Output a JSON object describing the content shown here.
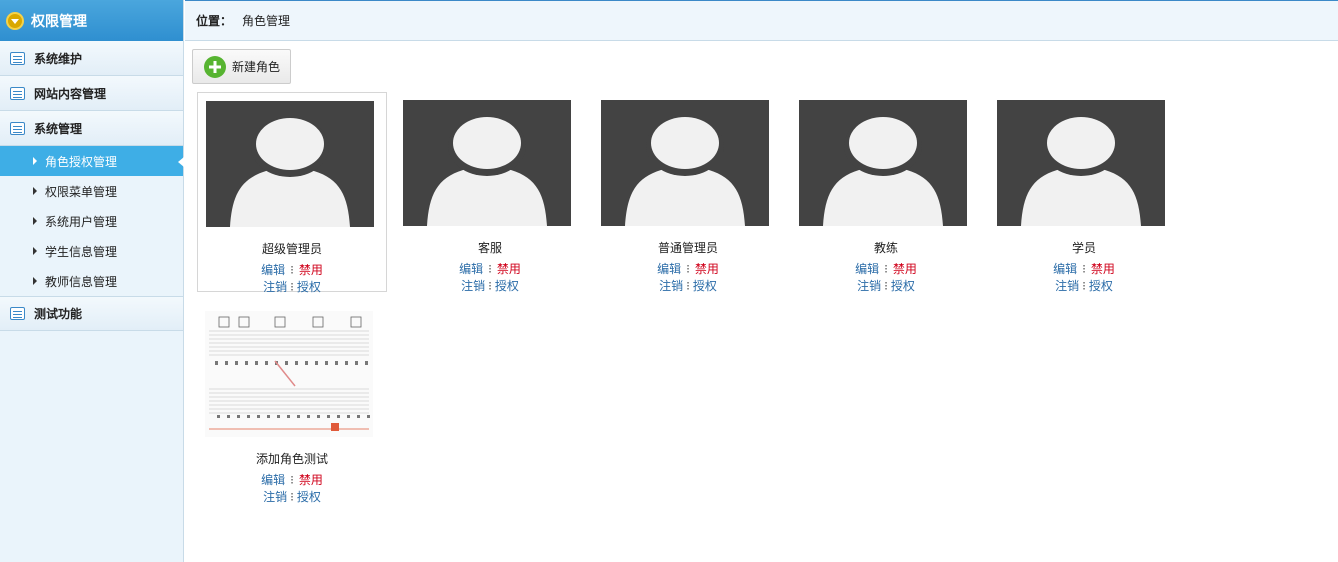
{
  "sidebar": {
    "title": "权限管理",
    "groups": [
      {
        "label": "系统维护"
      },
      {
        "label": "网站内容管理"
      },
      {
        "label": "系统管理"
      }
    ],
    "sub_items": [
      {
        "label": "角色授权管理",
        "active": true
      },
      {
        "label": "权限菜单管理"
      },
      {
        "label": "系统用户管理"
      },
      {
        "label": "学生信息管理"
      },
      {
        "label": "教师信息管理"
      }
    ],
    "last_group": {
      "label": "测试功能"
    }
  },
  "breadcrumb": {
    "label": "位置：",
    "value": "角色管理"
  },
  "toolbar": {
    "new_role_label": "新建角色"
  },
  "actions": {
    "edit": "编辑",
    "disable": "禁用",
    "cancel": "注销",
    "authorize": "授权",
    "separator": "⁝"
  },
  "roles": [
    {
      "name": "超级管理员",
      "thumb": "avatar-placeholder"
    },
    {
      "name": "客服",
      "thumb": "avatar-placeholder"
    },
    {
      "name": "普通管理员",
      "thumb": "avatar-placeholder"
    },
    {
      "name": "教练",
      "thumb": "avatar-placeholder"
    },
    {
      "name": "学员",
      "thumb": "avatar-placeholder"
    },
    {
      "name": "添加角色测试",
      "thumb": "music-sheet-image"
    }
  ],
  "colors": {
    "accent": "#3eaee6",
    "link": "#2b6ca8",
    "danger": "#d0021b",
    "placeholder_bg": "#434343"
  }
}
